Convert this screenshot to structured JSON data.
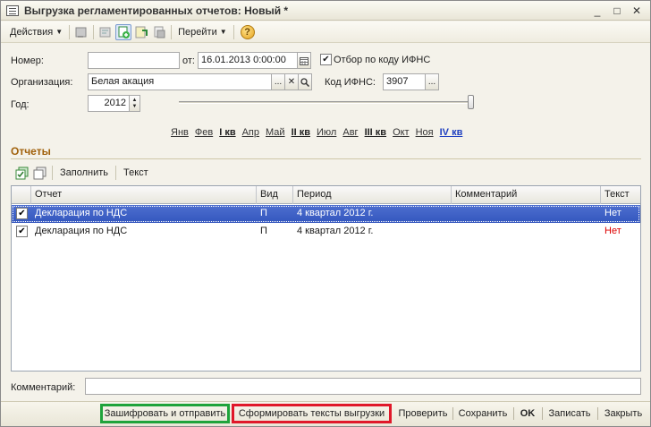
{
  "window": {
    "title": "Выгрузка регламентированных отчетов: Новый *",
    "min": "_",
    "max": "□",
    "close": "✕"
  },
  "toolbar": {
    "actions_label": "Действия",
    "goto_label": "Перейти",
    "help_label": "?"
  },
  "form": {
    "number_label": "Номер:",
    "number_value": "",
    "from_label": "от:",
    "date_value": "16.01.2013  0:00:00",
    "filter_checkbox_checked": true,
    "filter_label": "Отбор по коду ИФНС",
    "org_label": "Организация:",
    "org_value": "Белая акация",
    "ifns_label": "Код ИФНС:",
    "ifns_value": "3907",
    "year_label": "Год:",
    "year_value": "2012",
    "ellipsis": "...",
    "clear": "✕",
    "search": "Q"
  },
  "periods": [
    {
      "label": "Янв",
      "quarter": false
    },
    {
      "label": "Фев",
      "quarter": false
    },
    {
      "label": "I кв",
      "quarter": true
    },
    {
      "label": "Апр",
      "quarter": false
    },
    {
      "label": "Май",
      "quarter": false
    },
    {
      "label": "II кв",
      "quarter": true
    },
    {
      "label": "Июл",
      "quarter": false
    },
    {
      "label": "Авг",
      "quarter": false
    },
    {
      "label": "III кв",
      "quarter": true
    },
    {
      "label": "Окт",
      "quarter": false
    },
    {
      "label": "Ноя",
      "quarter": false
    },
    {
      "label": "IV кв",
      "quarter": true,
      "current": true
    }
  ],
  "reports": {
    "section_title": "Отчеты",
    "fill_label": "Заполнить",
    "text_label": "Текст",
    "columns": [
      "Отчет",
      "Вид",
      "Период",
      "Комментарий",
      "Текст"
    ],
    "rows": [
      {
        "checked": true,
        "report": "Декларация по НДС",
        "kind": "П",
        "period": "4 квартал 2012 г.",
        "comment": "",
        "text": "Нет",
        "selected": true
      },
      {
        "checked": true,
        "report": "Декларация по НДС",
        "kind": "П",
        "period": "4 квартал 2012 г.",
        "comment": "",
        "text": "Нет",
        "selected": false
      }
    ]
  },
  "comment": {
    "label": "Комментарий:",
    "value": ""
  },
  "footer": {
    "encrypt_send": "Зашифровать и отправить",
    "build_texts": "Сформировать тексты выгрузки",
    "check": "Проверить",
    "save": "Сохранить",
    "ok": "OK",
    "write": "Записать",
    "close": "Закрыть"
  },
  "colors": {
    "section_title": "#a0600a",
    "selected_row": "#3356be",
    "no_text": "#dd0000",
    "highlight_green": "#1fa33b",
    "highlight_red": "#e0182a"
  }
}
